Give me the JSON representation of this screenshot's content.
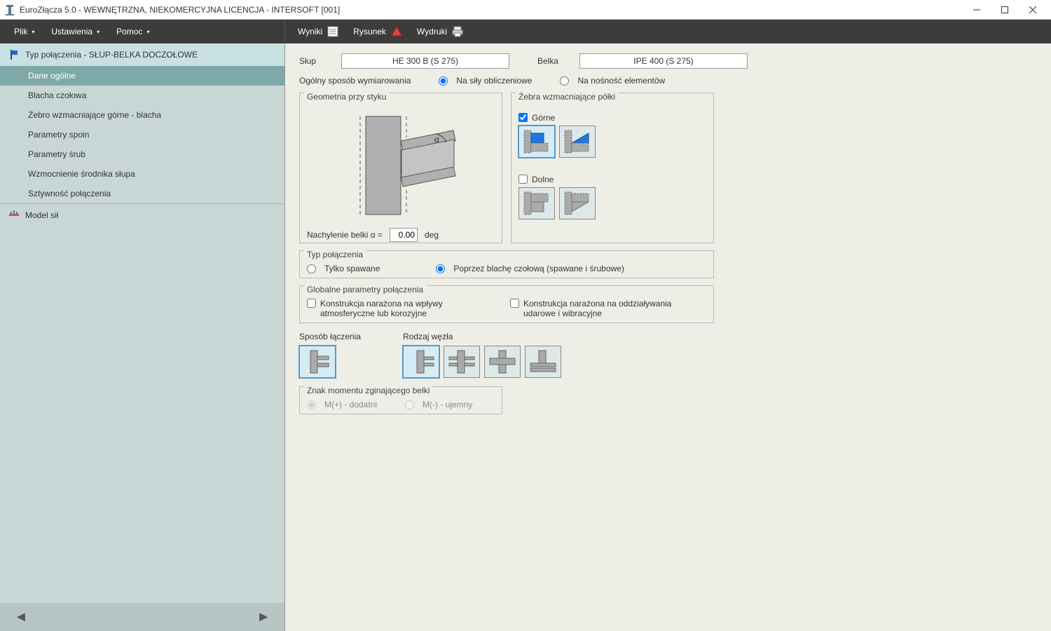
{
  "window": {
    "title": "EuroZłącza 5.0 - WEWNĘTRZNA, NIEKOMERCYJNA LICENCJA - INTERSOFT [001]"
  },
  "menu": {
    "plik": "Plik",
    "ustawienia": "Ustawienia",
    "pomoc": "Pomoc"
  },
  "toolbar": {
    "wyniki": "Wyniki",
    "rysunek": "Rysunek",
    "wydruki": "Wydruki"
  },
  "sidebar": {
    "header": "Typ połączenia - SŁUP-BELKA DOCZOŁOWE",
    "items": [
      "Dane ogólne",
      "Blacha czołowa",
      "Żebro wzmacniające górne - blacha",
      "Parametry spoin",
      "Parametry śrub",
      "Wzmocnienie środnika słupa",
      "Sztywność połączenia"
    ],
    "model_sil": "Model sił"
  },
  "form": {
    "slup_label": "Słup",
    "slup_value": "HE 300 B (S 275)",
    "belka_label": "Belka",
    "belka_value": "IPE 400 (S 275)",
    "ogolny_label": "Ogólny sposób wymiarowania",
    "radio_sily": "Na siły obliczeniowe",
    "radio_nosnosc": "Na nośność elementów",
    "geometria_legend": "Geometria przy styku",
    "nachylenie_label": "Nachylenie belki α =",
    "nachylenie_value": "0.00",
    "nachylenie_unit": "deg",
    "zebra_legend": "Żebra wzmacniające półki",
    "gorne": "Górne",
    "dolne": "Dolne",
    "typ_legend": "Typ połączenia",
    "typ_spawane": "Tylko spawane",
    "typ_blache": "Poprzez blachę czołową (spawane i śrubowe)",
    "glob_legend": "Globalne parametry połączenia",
    "glob_atm": "Konstrukcja narażona na wpływy atmosferyczne lub korozyjne",
    "glob_udar": "Konstrukcja narażona na oddziaływania udarowe i wibracyjne",
    "sposob_label": "Sposób łączenia",
    "rodzaj_label": "Rodzaj węzła",
    "znak_legend": "Znak momentu zginającego belki",
    "znak_plus": "M(+) - dodatni",
    "znak_minus": "M(-) - ujemny"
  }
}
